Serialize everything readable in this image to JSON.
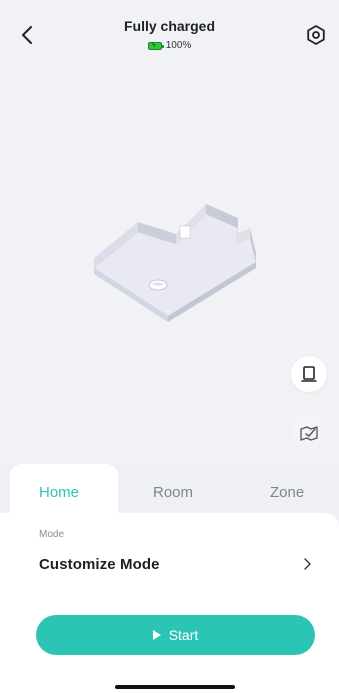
{
  "header": {
    "status_title": "Fully charged",
    "battery_text": "100%"
  },
  "tabs": [
    {
      "label": "Home",
      "active": true
    },
    {
      "label": "Room",
      "active": false
    },
    {
      "label": "Zone",
      "active": false
    }
  ],
  "mode": {
    "label": "Mode",
    "value": "Customize Mode"
  },
  "actions": {
    "start_label": "Start"
  },
  "icons": {
    "back": "chevron-left-icon",
    "settings": "gear-icon",
    "dock": "dock-icon",
    "map_edit": "map-edit-icon",
    "chevron": "chevron-right-icon"
  },
  "colors": {
    "accent": "#2bc5b4",
    "battery": "#37c43a",
    "background": "#f1f2f6"
  }
}
